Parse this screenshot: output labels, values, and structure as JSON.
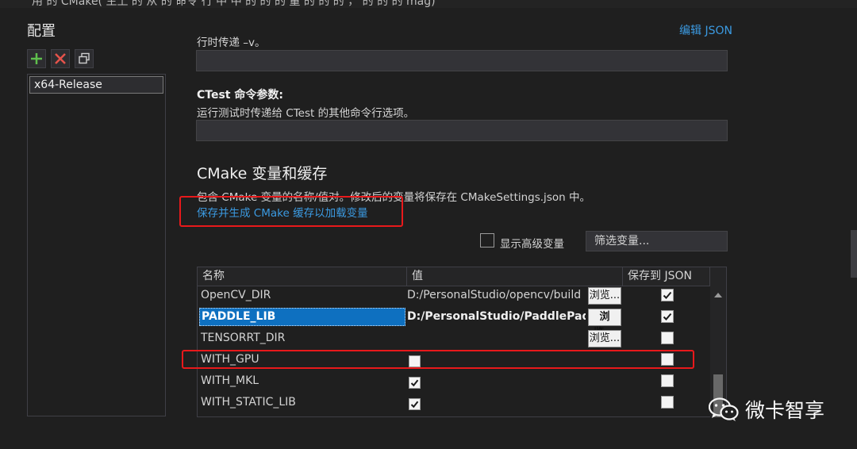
{
  "top_fragment": "用   的   CMake(   主上 的 从 的  命令 行 中    中 的 的 的 量   的 的 的 ，  的   的 的     mag)",
  "config_panel": {
    "title": "配置",
    "items": [
      "x64-Release"
    ]
  },
  "edit_json_link": "编辑 JSON",
  "ctest_section": {
    "prev_desc": "行时传递 –v。",
    "label": "CTest 命令参数:",
    "desc": "运行测试时传递给 CTest 的其他命令行选项。"
  },
  "cmake_vars": {
    "title": "CMake 变量和缓存",
    "desc": "包含 CMake 变量的名称/值对。修改后的变量将保存在 CMakeSettings.json 中。",
    "generate_link": "保存并生成 CMake 缓存以加载变量",
    "show_advanced_label": "显示高级变量",
    "show_advanced_checked": false,
    "filter_placeholder": "筛选变量..."
  },
  "grid": {
    "columns": [
      "名称",
      "值",
      "保存到 JSON"
    ],
    "browse_label": "浏览...",
    "rows": [
      {
        "name": "OpenCV_DIR",
        "value": "D:/PersonalStudio/opencv/build",
        "browse": true,
        "value_checkbox": null,
        "save_json": true,
        "selected": false
      },
      {
        "name": "PADDLE_LIB",
        "value": "D:/PersonalStudio/PaddlePaddle",
        "browse": true,
        "value_checkbox": null,
        "save_json": true,
        "selected": true
      },
      {
        "name": "TENSORRT_DIR",
        "value": "",
        "browse": true,
        "value_checkbox": null,
        "save_json": false,
        "selected": false
      },
      {
        "name": "WITH_GPU",
        "value": "",
        "browse": false,
        "value_checkbox": false,
        "save_json": false,
        "selected": false
      },
      {
        "name": "WITH_MKL",
        "value": "",
        "browse": false,
        "value_checkbox": true,
        "save_json": false,
        "selected": false
      },
      {
        "name": "WITH_STATIC_LIB",
        "value": "",
        "browse": false,
        "value_checkbox": true,
        "save_json": false,
        "selected": false
      }
    ]
  },
  "watermark": "微卡智享",
  "colors": {
    "accent_link": "#3b9ae1",
    "highlight_box": "#e8191b",
    "selection": "#0e70c0"
  }
}
